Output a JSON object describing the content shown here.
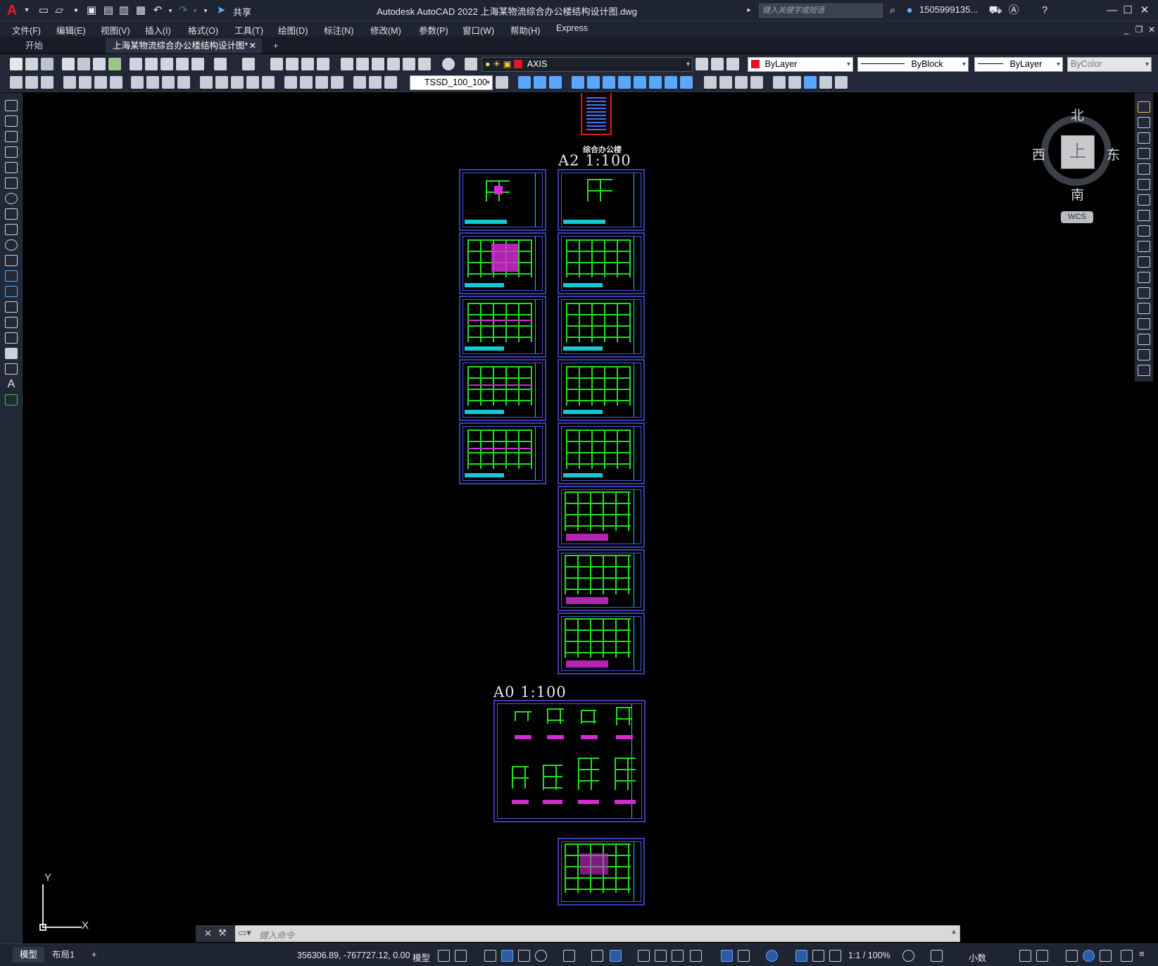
{
  "window": {
    "title": "Autodesk AutoCAD 2022    上海某物流综合办公楼结构设计图.dwg",
    "share_label": "共享",
    "search_placeholder": "键入关键字或短语",
    "user": "1505999135...",
    "logo": "A"
  },
  "menu": [
    "文件(F)",
    "编辑(E)",
    "视图(V)",
    "插入(I)",
    "格式(O)",
    "工具(T)",
    "绘图(D)",
    "标注(N)",
    "修改(M)",
    "参数(P)",
    "窗口(W)",
    "帮助(H)",
    "Express"
  ],
  "tabs": {
    "start": "开始",
    "doc": "上海某物流综合办公楼结构设计图*",
    "add": "+"
  },
  "toolbar": {
    "layer": "AXIS",
    "layer_color": "#e81123",
    "color_value": "ByLayer",
    "linetype": "ByBlock",
    "lineweight": "ByLayer",
    "plotstyle": "ByColor",
    "style_combo": "TSSD_100_100"
  },
  "drawing": {
    "cover_title": "综合办公楼",
    "label_a2": "A2  1:100",
    "label_a0": "A0  1:100"
  },
  "viewcube": {
    "north": "北",
    "south": "南",
    "east": "东",
    "west": "西",
    "top": "上",
    "wcs": "WCS"
  },
  "ucs": {
    "x": "X",
    "y": "Y"
  },
  "command": {
    "placeholder": "键入命令"
  },
  "status": {
    "tab_model": "模型",
    "tab_layout": "布局1",
    "coords": "356306.89, -767727.12, 0.00",
    "mode": "模型",
    "scale": "1:1 / 100%",
    "units": "小数"
  }
}
